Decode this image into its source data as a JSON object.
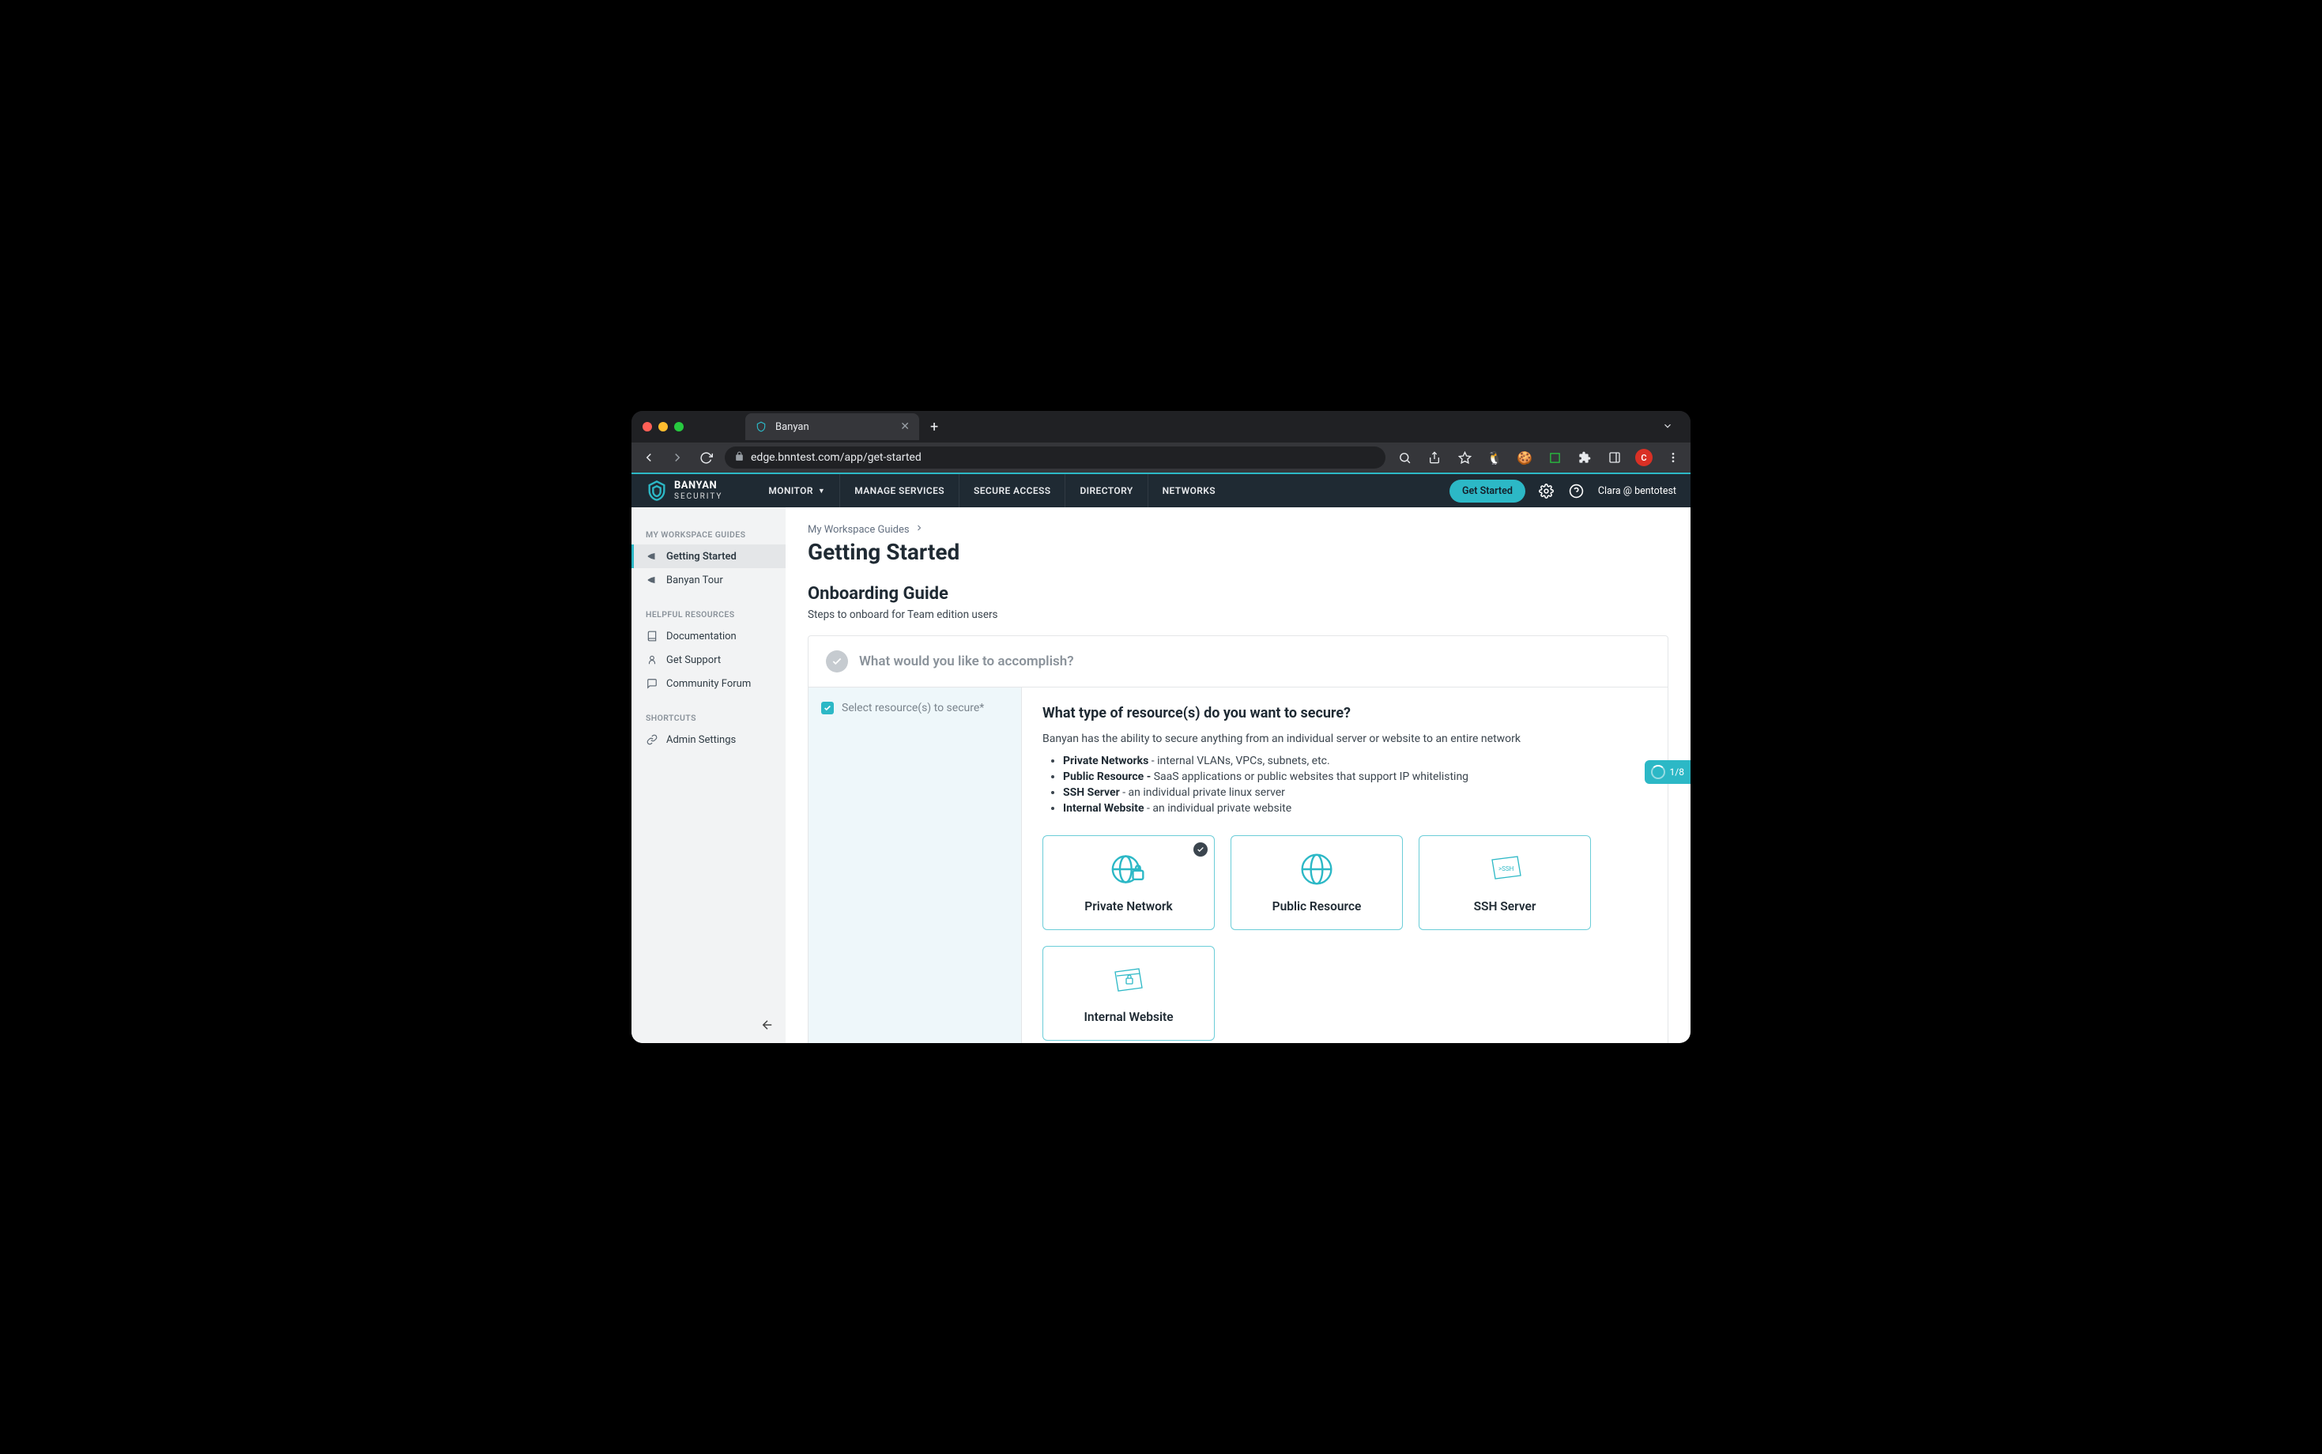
{
  "browser": {
    "tab_title": "Banyan",
    "url": "edge.bnntest.com/app/get-started",
    "avatar_letter": "C"
  },
  "header": {
    "brand_top": "BANYAN",
    "brand_bottom": "SECURITY",
    "nav": {
      "monitor": "MONITOR",
      "manage": "MANAGE SERVICES",
      "secure": "SECURE ACCESS",
      "directory": "DIRECTORY",
      "networks": "NETWORKS"
    },
    "cta": "Get Started",
    "user": "Clara @ bentotest"
  },
  "sidebar": {
    "section1": "MY WORKSPACE GUIDES",
    "items1": {
      "getting_started": "Getting Started",
      "tour": "Banyan Tour"
    },
    "section2": "HELPFUL RESOURCES",
    "items2": {
      "docs": "Documentation",
      "support": "Get Support",
      "forum": "Community Forum"
    },
    "section3": "SHORTCUTS",
    "items3": {
      "admin": "Admin Settings"
    }
  },
  "main": {
    "breadcrumb": "My Workspace Guides",
    "title": "Getting Started",
    "subheading": "Onboarding Guide",
    "subsub": "Steps to onboard for Team edition users",
    "step_done": "What would you like to accomplish?",
    "step_active": "Select resource(s) to secure*",
    "question": "What type of resource(s) do you want to secure?",
    "desc": "Banyan has the ability to secure anything from an individual server or website to an entire network",
    "bullets": {
      "b1_label": "Private Networks",
      "b1_text": " - internal VLANs, VPCs, subnets, etc.",
      "b2_label": "Public Resource - ",
      "b2_text": "SaaS applications or public websites that support IP whitelisting",
      "b3_label": "SSH Server",
      "b3_text": " - an individual private linux server",
      "b4_label": "Internal Website",
      "b4_text": " - an individual private website"
    },
    "cards": {
      "c1": "Private Network",
      "c2": "Public Resource",
      "c3": "SSH Server",
      "c4": "Internal Website"
    },
    "progress": "1/8"
  }
}
